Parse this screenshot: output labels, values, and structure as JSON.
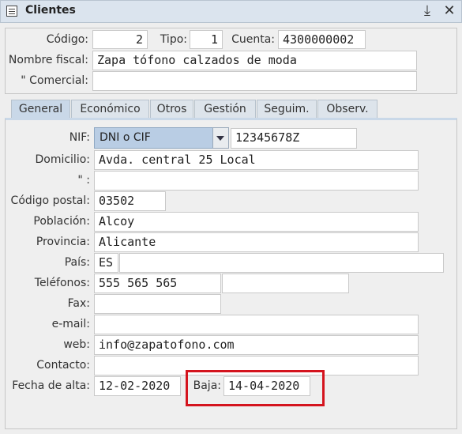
{
  "window": {
    "title": "Clientes"
  },
  "header": {
    "codigo_label": "Código:",
    "codigo_value": "2",
    "tipo_label": "Tipo:",
    "tipo_value": "1",
    "cuenta_label": "Cuenta:",
    "cuenta_value": "4300000002",
    "nombre_fiscal_label": "Nombre fiscal:",
    "nombre_fiscal_value": "Zapa tófono calzados de moda",
    "comercial_label": "\" Comercial:",
    "comercial_value": ""
  },
  "tabs": [
    {
      "label": "General",
      "active": true
    },
    {
      "label": "Económico"
    },
    {
      "label": "Otros"
    },
    {
      "label": "Gestión"
    },
    {
      "label": "Seguim."
    },
    {
      "label": "Observ."
    }
  ],
  "general": {
    "nif_label": "NIF:",
    "nif_type": "DNI o CIF",
    "nif_value": "12345678Z",
    "domicilio_label": "Domicilio:",
    "domicilio_value": "Avda. central 25 Local",
    "domicilio2_label": "\" :",
    "domicilio2_value": "",
    "cp_label": "Código postal:",
    "cp_value": "03502",
    "poblacion_label": "Población:",
    "poblacion_value": "Alcoy",
    "provincia_label": "Provincia:",
    "provincia_value": "Alicante",
    "pais_label": "País:",
    "pais_code": "ES",
    "pais_name": "",
    "telefonos_label": "Teléfonos:",
    "telefono1": "555 565 565",
    "telefono2": "",
    "fax_label": "Fax:",
    "fax_value": "",
    "email_label": "e-mail:",
    "email_value": "",
    "web_label": "web:",
    "web_value": "info@zapatofono.com",
    "contacto_label": "Contacto:",
    "contacto_value": "",
    "fecha_alta_label": "Fecha de alta:",
    "fecha_alta_value": "12-02-2020",
    "baja_label": "Baja:",
    "baja_value": "14-04-2020"
  },
  "colors": {
    "highlight": "#d4141e",
    "combo": "#b9cde4",
    "active_tab": "#c9d8e8"
  }
}
